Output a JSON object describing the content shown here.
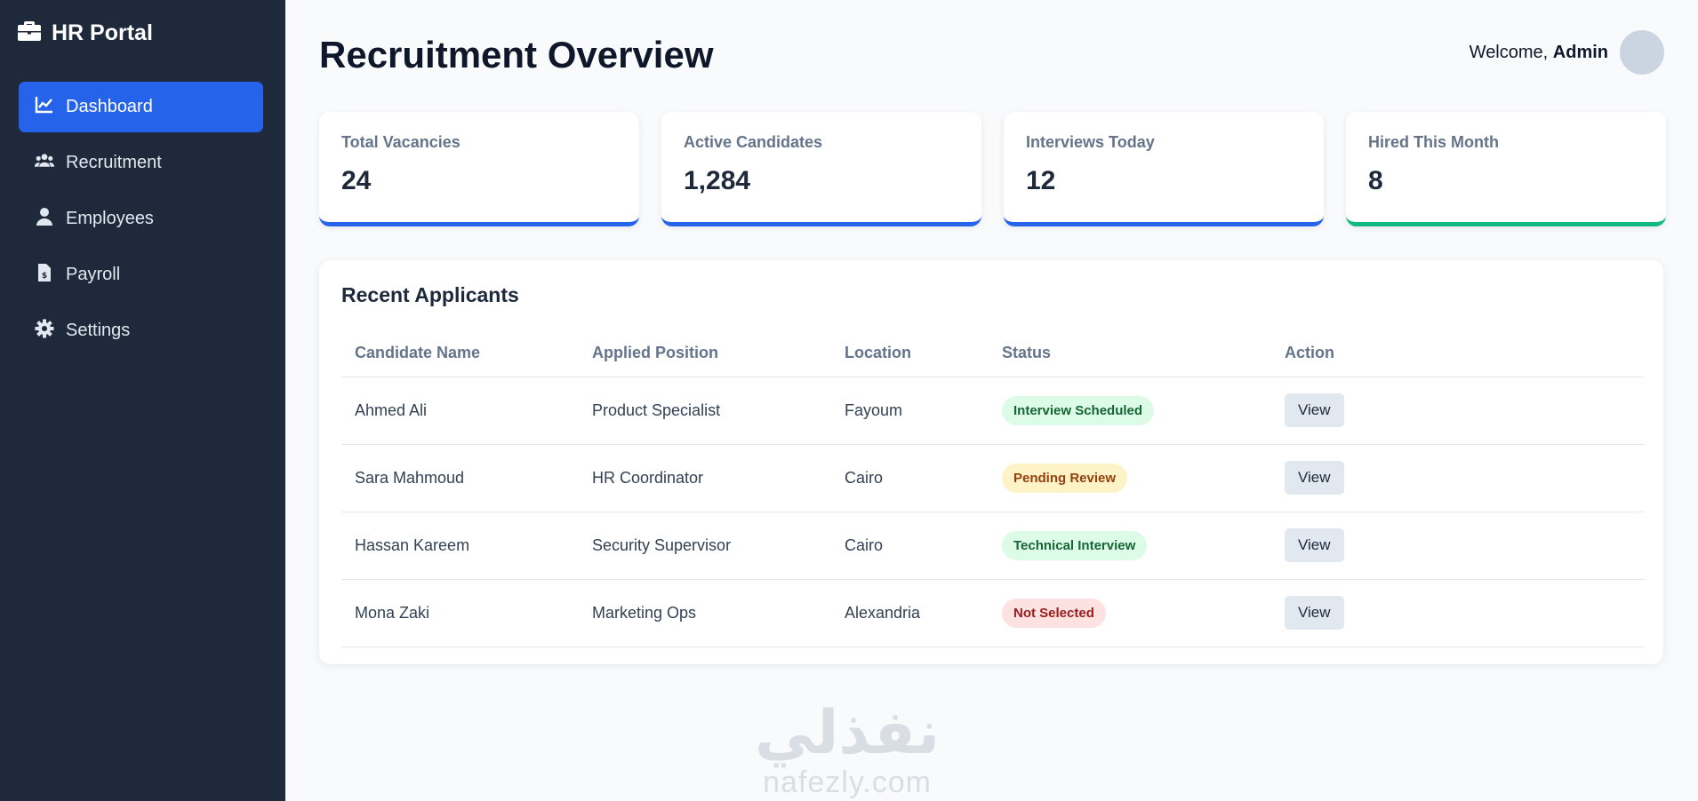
{
  "brand": {
    "title": "HR Portal",
    "icon": "briefcase-icon"
  },
  "sidebar": {
    "items": [
      {
        "label": "Dashboard",
        "icon": "chart-line-icon",
        "active": true
      },
      {
        "label": "Recruitment",
        "icon": "users-icon",
        "active": false
      },
      {
        "label": "Employees",
        "icon": "user-icon",
        "active": false
      },
      {
        "label": "Payroll",
        "icon": "invoice-dollar-icon",
        "active": false
      },
      {
        "label": "Settings",
        "icon": "gear-icon",
        "active": false
      }
    ]
  },
  "header": {
    "title": "Recruitment Overview",
    "welcome_prefix": "Welcome,",
    "user_name": "Admin"
  },
  "stats": [
    {
      "label": "Total Vacancies",
      "value": "24"
    },
    {
      "label": "Active Candidates",
      "value": "1,284"
    },
    {
      "label": "Interviews Today",
      "value": "12"
    },
    {
      "label": "Hired This Month",
      "value": "8"
    }
  ],
  "applicants": {
    "title": "Recent Applicants",
    "columns": [
      "Candidate Name",
      "Applied Position",
      "Location",
      "Status",
      "Action"
    ],
    "rows": [
      {
        "name": "Ahmed Ali",
        "position": "Product Specialist",
        "location": "Fayoum",
        "status": "Interview Scheduled",
        "action": "View"
      },
      {
        "name": "Sara Mahmoud",
        "position": "HR Coordinator",
        "location": "Cairo",
        "status": "Pending Review",
        "action": "View"
      },
      {
        "name": "Hassan Kareem",
        "position": "Security Supervisor",
        "location": "Cairo",
        "status": "Technical Interview",
        "action": "View"
      },
      {
        "name": "Mona Zaki",
        "position": "Marketing Ops",
        "location": "Alexandria",
        "status": "Not Selected",
        "action": "View"
      }
    ]
  },
  "watermark": {
    "arabic": "نفذلي",
    "latin": "nafezly.com"
  },
  "colors": {
    "sidebar_bg": "#1e293b",
    "accent": "#2563eb",
    "success_accent": "#10b981"
  }
}
